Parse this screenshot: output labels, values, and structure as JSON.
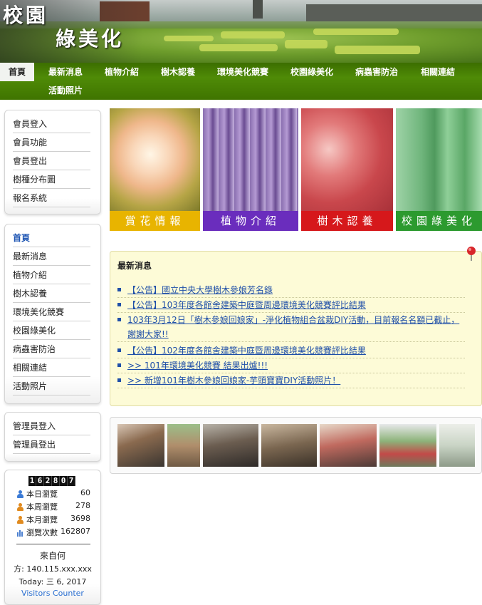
{
  "header": {
    "title_line1": "校園",
    "title_line2": "綠美化"
  },
  "nav": {
    "items": [
      {
        "label": "首頁",
        "active": true
      },
      {
        "label": "最新消息"
      },
      {
        "label": "植物介紹"
      },
      {
        "label": "樹木認養"
      },
      {
        "label": "環境美化競賽"
      },
      {
        "label": "校園綠美化"
      },
      {
        "label": "病蟲害防治"
      },
      {
        "label": "相關連結"
      },
      {
        "label": "活動照片"
      }
    ]
  },
  "sidebar": {
    "member_menu": [
      "會員登入",
      "會員功能",
      "會員登出",
      "樹種分布圖",
      "報名系統"
    ],
    "main_menu": [
      "首頁",
      "最新消息",
      "植物介紹",
      "樹木認養",
      "環境美化競賽",
      "校園綠美化",
      "病蟲害防治",
      "相關連結",
      "活動照片"
    ],
    "admin_menu": [
      "管理員登入",
      "管理員登出"
    ],
    "counter": {
      "digits": "162807",
      "stats": [
        {
          "label": "本日瀏覽",
          "value": "60",
          "icon": "user-icon",
          "color": "#3b7bd6"
        },
        {
          "label": "本周瀏覽",
          "value": "278",
          "icon": "user-icon",
          "color": "#e08a1e"
        },
        {
          "label": "本月瀏覽",
          "value": "3698",
          "icon": "user-icon",
          "color": "#e08a1e"
        },
        {
          "label": "瀏覽次數",
          "value": "162807",
          "icon": "bar-chart-icon",
          "color": "#4a7fd0"
        }
      ],
      "from_label": "來自何",
      "ip_line": "方: 140.115.xxx.xxx",
      "today_line": "Today: 三 6, 2017",
      "counter_link": "Visitors Counter"
    }
  },
  "tiles": [
    {
      "caption": "賞花情報",
      "color": "#e8b400"
    },
    {
      "caption": "植物介紹",
      "color": "#6a2dbd"
    },
    {
      "caption": "樹木認養",
      "color": "#d6181b"
    },
    {
      "caption": "校園綠美化",
      "color": "#2c9a2f"
    }
  ],
  "news": {
    "title": "最新消息",
    "items": [
      "【公告】國立中央大學樹木參娘芳名錄",
      "【公告】103年度各館舍建築中庭暨周邊環境美化競賽評比結果",
      "103年3月12日「樹木參娘回娘家」-淨化植物組合盆栽DIY活動，目前報名名額已截止，謝謝大家!!",
      "【公告】102年度各館舍建築中庭暨周邊環境美化競賽評比結果",
      ">> 101年環境美化競賽 結果出爐!!!",
      ">> 新增101年樹木參娘回娘家-芋頭寶寶DIY活動照片！"
    ]
  },
  "photos": 7
}
